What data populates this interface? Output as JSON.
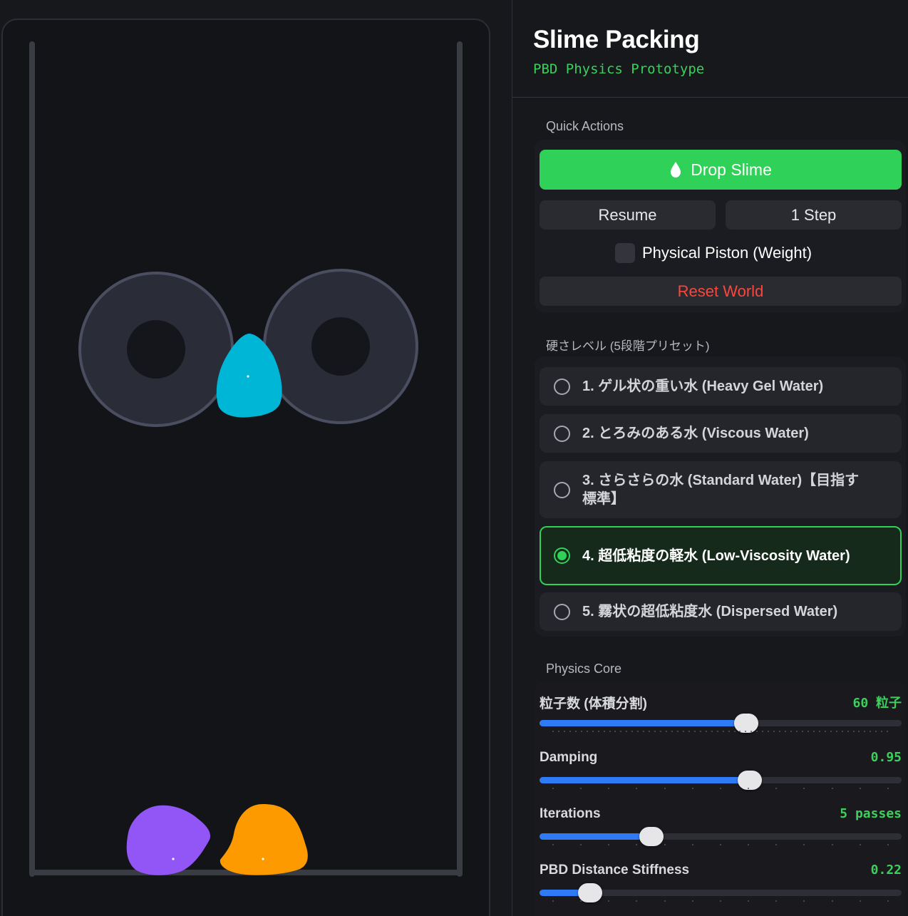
{
  "header": {
    "title": "Slime Packing",
    "subtitle": "PBD Physics Prototype"
  },
  "quick_actions": {
    "label": "Quick Actions",
    "drop_label": "Drop Slime",
    "resume_label": "Resume",
    "step_label": "1 Step",
    "piston_label": "Physical Piston (Weight)",
    "piston_checked": false,
    "reset_label": "Reset World"
  },
  "presets": {
    "label": "硬さレベル (5段階プリセット)",
    "selected_index": 3,
    "items": [
      {
        "label": "1. ゲル状の重い水 (Heavy Gel Water)"
      },
      {
        "label": "2. とろみのある水 (Viscous Water)"
      },
      {
        "label": "3. さらさらの水 (Standard Water)【目指す標準】"
      },
      {
        "label": "4. 超低粘度の軽水 (Low-Viscosity Water)"
      },
      {
        "label": "5. 霧状の超低粘度水 (Dispersed Water)"
      }
    ]
  },
  "physics_core": {
    "label": "Physics Core",
    "sliders": [
      {
        "label": "粒子数 (体積分割)",
        "value_text": "60 粒子",
        "fraction": 0.57
      },
      {
        "label": "Damping",
        "value_text": "0.95",
        "fraction": 0.58
      },
      {
        "label": "Iterations",
        "value_text": "5 passes",
        "fraction": 0.31
      },
      {
        "label": "PBD Distance Stiffness",
        "value_text": "0.22",
        "fraction": 0.14
      }
    ]
  },
  "simulation": {
    "gears": 2,
    "slimes": [
      {
        "name": "cyan-slime",
        "color": "#00b6d6"
      },
      {
        "name": "purple-slime",
        "color": "#9156f5"
      },
      {
        "name": "orange-slime",
        "color": "#fd9a00"
      }
    ]
  },
  "colors": {
    "accent_green": "#30d158",
    "slider_blue": "#2f7bf6",
    "danger_red": "#ff453a",
    "container_wall": "#3a3c44",
    "gear_fill": "#2a2d38",
    "gear_stroke": "#4a4e60"
  }
}
